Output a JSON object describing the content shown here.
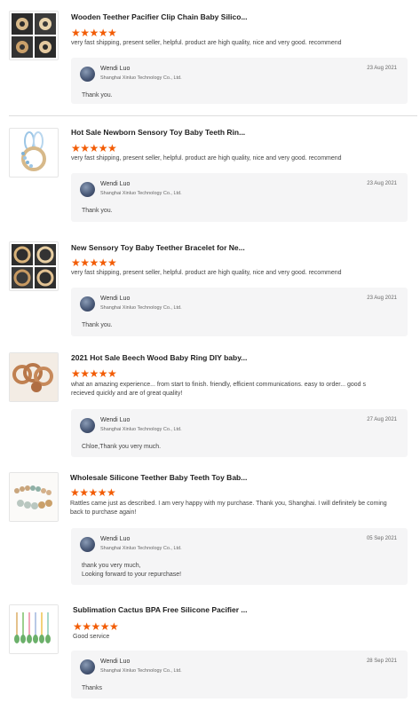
{
  "reviews": [
    {
      "icon": "teether-clip-chain-image",
      "title": "Wooden Teether Pacifier Clip Chain Baby Silico...",
      "stars": "★★★★★",
      "comment": "very fast shipping,  present seller, helpful. product are high quality, nice and very good. recommend",
      "reply": {
        "name": "Wendi Luo",
        "company": "Shanghai Xinluo Technology Co., Ltd.",
        "date": "23 Aug 2021",
        "text": "Thank you."
      }
    },
    {
      "icon": "sensory-toy-teeth-ring-image",
      "title": "Hot Sale Newborn Sensory Toy Baby Teeth Rin...",
      "stars": "★★★★★",
      "comment": "very fast shipping,  present seller, helpful. product are high quality, nice and very good. recommend",
      "reply": {
        "name": "Wendi Luo",
        "company": "Shanghai Xinluo Technology Co., Ltd.",
        "date": "23 Aug 2021",
        "text": "Thank you."
      }
    },
    {
      "icon": "teether-bracelet-image",
      "title": "New Sensory Toy Baby Teether Bracelet for Ne...",
      "stars": "★★★★★",
      "comment": "very fast shipping,  present seller, helpful. product are high quality, nice and very good. recommend",
      "reply": {
        "name": "Wendi Luo",
        "company": "Shanghai Xinluo Technology Co., Ltd.",
        "date": "23 Aug 2021",
        "text": "Thank you."
      }
    },
    {
      "icon": "beech-wood-ring-image",
      "title": "2021 Hot Sale Beech Wood Baby Ring DIY baby...",
      "stars": "★★★★★",
      "comment": "what an amazing experience... from start to finish. friendly, efficient communications. easy to order... good s recieved quickly and are of great quality!",
      "reply": {
        "name": "Wendi Luo",
        "company": "Shanghai Xinluo Technology Co., Ltd.",
        "date": "27 Aug 2021",
        "text": "Chloe,Thank you very much."
      }
    },
    {
      "icon": "silicone-teether-beads-image",
      "title": "Wholesale Silicone Teether Baby Teeth Toy Bab...",
      "stars": "★★★★★",
      "comment": "Rattles came just as described. I am very happy with my purchase. Thank you, Shanghai. I will definitely be coming back to purchase again!",
      "reply": {
        "name": "Wendi Luo",
        "company": "Shanghai Xinluo Technology Co., Ltd.",
        "date": "05 Sep 2021",
        "text": "thank you very much,\nLooking forward to your repurchase!"
      }
    },
    {
      "icon": "cactus-pacifier-clips-image",
      "title": "Sublimation Cactus BPA Free Silicone Pacifier ...",
      "stars": "★★★★★",
      "comment": "Good service",
      "reply": {
        "name": "Wendi Luo",
        "company": "Shanghai Xinluo Technology Co., Ltd.",
        "date": "28 Sep 2021",
        "text": "Thanks"
      }
    }
  ]
}
